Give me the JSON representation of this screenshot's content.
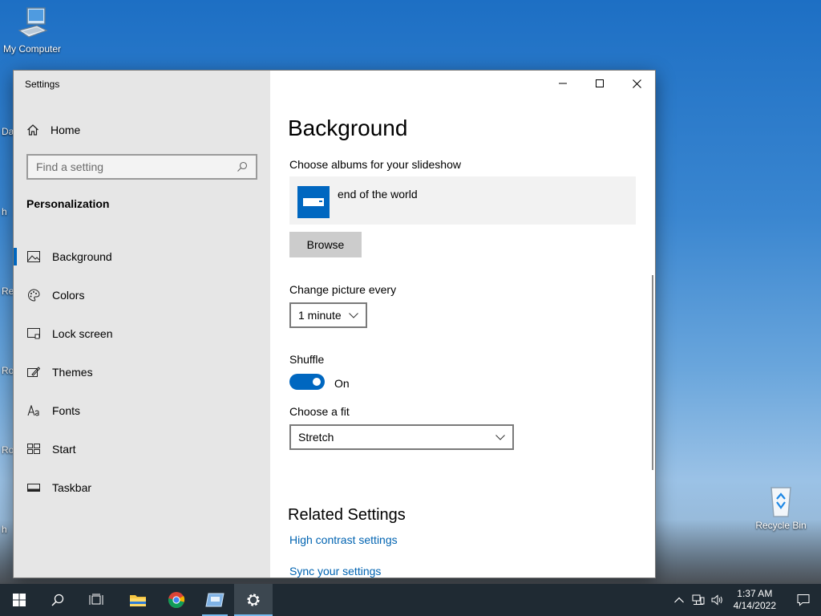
{
  "desktop": {
    "icons": {
      "my_computer": "My Computer",
      "recycle_bin": "Recycle Bin"
    },
    "edge_labels": [
      "Da",
      "h",
      "Re",
      "Ro",
      "Ro",
      "h"
    ]
  },
  "window": {
    "app_title": "Settings",
    "controls": {
      "minimize_icon": "minimize-icon",
      "maximize_icon": "maximize-icon",
      "close_icon": "close-icon"
    }
  },
  "sidebar": {
    "home_label": "Home",
    "search": {
      "placeholder": "Find a setting",
      "icon": "search-icon"
    },
    "section_title": "Personalization",
    "items": [
      {
        "label": "Background",
        "icon": "picture-icon",
        "selected": true
      },
      {
        "label": "Colors",
        "icon": "palette-icon",
        "selected": false
      },
      {
        "label": "Lock screen",
        "icon": "lock-screen-icon",
        "selected": false
      },
      {
        "label": "Themes",
        "icon": "themes-icon",
        "selected": false
      },
      {
        "label": "Fonts",
        "icon": "fonts-icon",
        "selected": false
      },
      {
        "label": "Start",
        "icon": "start-icon",
        "selected": false
      },
      {
        "label": "Taskbar",
        "icon": "taskbar-icon",
        "selected": false
      }
    ]
  },
  "main": {
    "page_title": "Background",
    "albums_label": "Choose albums for your slideshow",
    "album_name": "end of the world",
    "browse_label": "Browse",
    "change_picture_label": "Change picture every",
    "change_picture_value": "1 minute",
    "shuffle_label": "Shuffle",
    "shuffle_state": "On",
    "fit_label": "Choose a fit",
    "fit_value": "Stretch",
    "related_title": "Related Settings",
    "links": [
      "High contrast settings",
      "Sync your settings"
    ]
  },
  "taskbar": {
    "clock_time": "1:37 AM",
    "clock_date": "4/14/2022",
    "accent": "#76b9ed"
  },
  "colors": {
    "accent": "#0067c0",
    "link": "#0063b1",
    "sidebar_bg": "#e6e6e6"
  }
}
